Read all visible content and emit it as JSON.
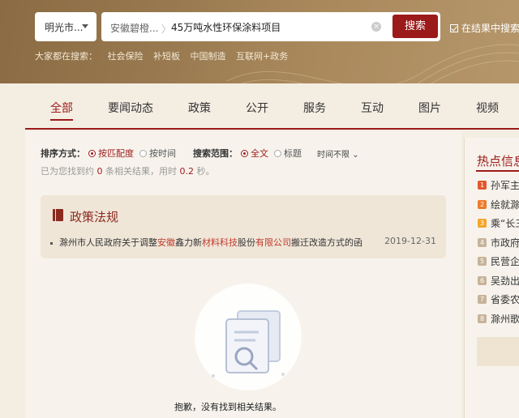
{
  "header": {
    "city": "明光市...",
    "search_scope": "安徽碧橙...",
    "search_sep": "〉",
    "search_query": "45万吨水性环保涂料项目",
    "clear_icon": "×",
    "search_button": "搜索",
    "in_result_label": "在结果中搜索",
    "hot_search_label": "大家都在搜索：",
    "hot_terms": [
      "社会保险",
      "补短板",
      "中国制造",
      "互联网+政务"
    ]
  },
  "nav": {
    "items": [
      "全部",
      "要闻动态",
      "政策",
      "公开",
      "服务",
      "互动",
      "图片",
      "视频"
    ],
    "active_index": 0
  },
  "filters": {
    "sort_label": "排序方式：",
    "sort_options": [
      "按匹配度",
      "按时间"
    ],
    "sort_selected": 0,
    "scope_label": "搜索范围：",
    "scope_options": [
      "全文",
      "标题"
    ],
    "scope_selected": 0,
    "time_label": "时间不限"
  },
  "result_info": {
    "prefix": "已为您找到约",
    "count": "0",
    "middle": "条相关结果，用时",
    "time": "0.2",
    "suffix": "秒。"
  },
  "policy_section": {
    "title": "政策法规",
    "item_parts": [
      {
        "text": "滁州市人民政府关于调整",
        "hl": false
      },
      {
        "text": "安徽",
        "hl": true
      },
      {
        "text": "鑫力新",
        "hl": false
      },
      {
        "text": "材料科技",
        "hl": true
      },
      {
        "text": "股份",
        "hl": false
      },
      {
        "text": "有限公司",
        "hl": true
      },
      {
        "text": "搬迁改造方式的函",
        "hl": false
      }
    ],
    "item_date": "2019-12-31"
  },
  "empty_message": "抱歉，没有找到相关结果。",
  "sidebar": {
    "title": "热点信息",
    "items": [
      {
        "rank": "1",
        "text": "孙军主持",
        "color": "#e2572d"
      },
      {
        "rank": "2",
        "text": "绘就滁州",
        "color": "#ee7a2b"
      },
      {
        "rank": "3",
        "text": "乘“长三",
        "color": "#f3a52a"
      },
      {
        "rank": "4",
        "text": "市政府常",
        "color": "#c7b399"
      },
      {
        "rank": "5",
        "text": "民营企业",
        "color": "#c7b399"
      },
      {
        "rank": "6",
        "text": "吴劲出席",
        "color": "#c7b399"
      },
      {
        "rank": "7",
        "text": "省委农村",
        "color": "#c7b399"
      },
      {
        "rank": "8",
        "text": "滁州歌手",
        "color": "#c7b399"
      }
    ]
  },
  "colors": {
    "accent": "#9b1a1a",
    "header_bg": "#9a7a50",
    "page_bg": "#f3ede2"
  }
}
